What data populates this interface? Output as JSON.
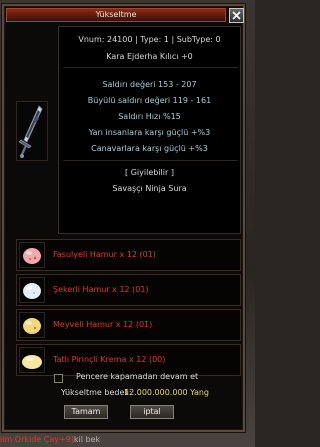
{
  "window": {
    "title": "Yükseltme",
    "close_glyph": "✕"
  },
  "tooltip": {
    "vnum_line": "Vnum: 24100 | Type: 1 | SubType: 0",
    "item_name": "Kara Ejderha Kılıcı +0",
    "stats": [
      "Saldırı değeri 153 - 207",
      "Büyülü saldırı değeri 119 - 161",
      "Saldırı Hızı %15",
      "Yarı insanlara karşı güçlü +%3",
      "Canavarlara karşı güçlü +%3"
    ],
    "wearable": "[ Giyilebilir ]",
    "classes": "Savaşçı Ninja Sura"
  },
  "materials": [
    {
      "label": "Fasulyeli Hamur x 12 (01)",
      "icon": "pink-dough-icon",
      "color": "#f3a9a9"
    },
    {
      "label": "Şekerli Hamur x 12 (01)",
      "icon": "white-dough-icon",
      "color": "#e4edf2"
    },
    {
      "label": "Meyveli Hamur x 12 (01)",
      "icon": "yellow-dough-icon",
      "color": "#f2d77d"
    },
    {
      "label": "Tatlı Pirinçli Krema x 12 (00)",
      "icon": "cream-dough-icon",
      "color": "#f6e7a4"
    }
  ],
  "options": {
    "keep_open_label": "Pencere kapamadan devam et",
    "keep_open_checked": false
  },
  "cost": {
    "label": "Yükseltme bedeli:",
    "value": "12.000.000.000 Yang"
  },
  "buttons": {
    "ok": "Tamam",
    "cancel": "iptal"
  },
  "chat_bleed": {
    "red": "lim Orkide Çay+9]",
    "grey": "kil bek"
  },
  "colors": {
    "title_bar": "#7a2414",
    "stat_text": "#a7cdd6",
    "material_text": "#e03a28",
    "cost_value": "#e7d36a"
  }
}
